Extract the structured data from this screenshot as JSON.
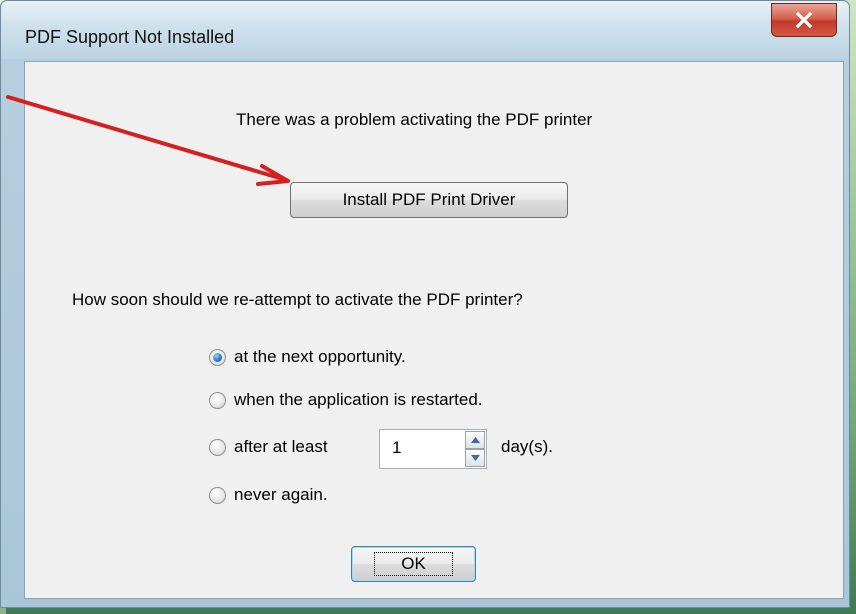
{
  "window": {
    "title": "PDF Support Not Installed",
    "close_icon": "close-x-icon"
  },
  "dialog": {
    "problem_text": "There was a problem activating the PDF printer",
    "install_button_label": "Install PDF Print Driver",
    "question_text": "How soon should we re-attempt to activate the PDF printer?",
    "options": [
      {
        "label": "at the next opportunity.",
        "selected": true
      },
      {
        "label": "when the application is restarted.",
        "selected": false
      },
      {
        "label": "after at least",
        "selected": false
      },
      {
        "label": "never again.",
        "selected": false
      }
    ],
    "days_value": "1",
    "days_unit": "day(s).",
    "ok_button_label": "OK"
  },
  "annotation": {
    "arrow_color": "#d62020",
    "arrow_icon": "red-pointer-arrow"
  },
  "colors": {
    "close_button": "#c0392b",
    "radio_selected": "#2a7bd1"
  }
}
